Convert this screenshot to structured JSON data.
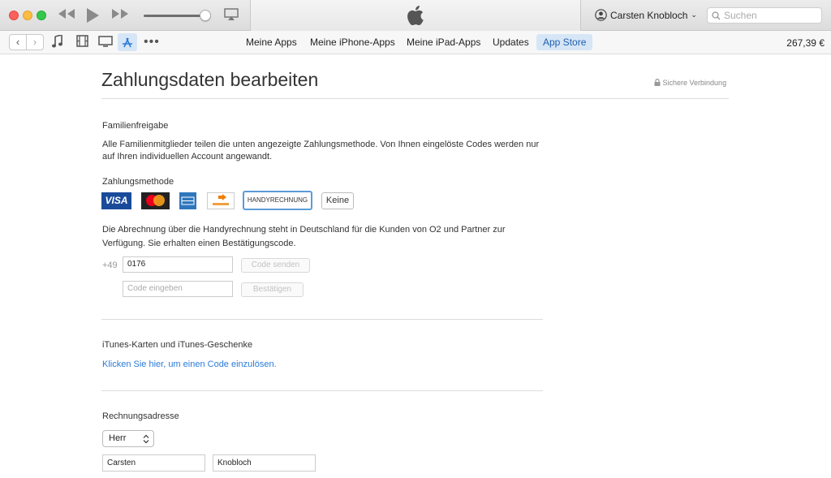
{
  "titlebar": {
    "rewind_icon": "rewind-icon",
    "play_icon": "play-icon",
    "forward_icon": "fast-forward-icon",
    "airplay_icon": "airplay-icon",
    "apple_icon": "apple-logo",
    "account_name": "Carsten Knobloch",
    "search_placeholder": "Suchen",
    "volume_level": 0.95
  },
  "navbar": {
    "back": "‹",
    "forward": "›",
    "media_icons": [
      "music-icon",
      "film-icon",
      "tv-icon",
      "app-store-icon",
      "more-icon"
    ],
    "tabs": [
      {
        "label": "Meine Apps",
        "active": false
      },
      {
        "label": "Meine iPhone-Apps",
        "active": false
      },
      {
        "label": "Meine iPad-Apps",
        "active": false
      },
      {
        "label": "Updates",
        "active": false
      },
      {
        "label": "App Store",
        "active": true
      }
    ],
    "balance": "267,39 €"
  },
  "page": {
    "title": "Zahlungsdaten bearbeiten",
    "secure": "Sichere Verbindung",
    "family": {
      "heading": "Familienfreigabe",
      "text_line1": "Alle Familienmitglieder teilen die unten angezeigte Zahlungsmethode. Von Ihnen eingelöste Codes werden nur",
      "text_line2": "auf Ihren individuellen Account angewandt."
    },
    "payment": {
      "heading": "Zahlungsmethode",
      "visa": "VISA",
      "handy": "HANDYRECHNUNG",
      "none": "Keine",
      "info_line1": "Die Abrechnung über die Handyrechnung steht in Deutschland für die Kunden von O2 und Partner zur",
      "info_line2": "Verfügung. Sie erhalten einen Bestätigungscode.",
      "prefix": "+49",
      "phone": "0176",
      "send_code": "Code senden",
      "code_placeholder": "Code eingeben",
      "confirm": "Bestätigen"
    },
    "itunes": {
      "heading": "iTunes-Karten und iTunes-Geschenke",
      "link": "Klicken Sie hier, um einen Code einzulösen."
    },
    "billing": {
      "heading": "Rechnungsadresse",
      "salutation": "Herr",
      "first_name": "Carsten",
      "last_name": "Knobloch"
    }
  },
  "colors": {
    "accent": "#2a7bd6",
    "active_tab_bg": "#d6e6f6",
    "visa_blue": "#1a4b9b"
  }
}
